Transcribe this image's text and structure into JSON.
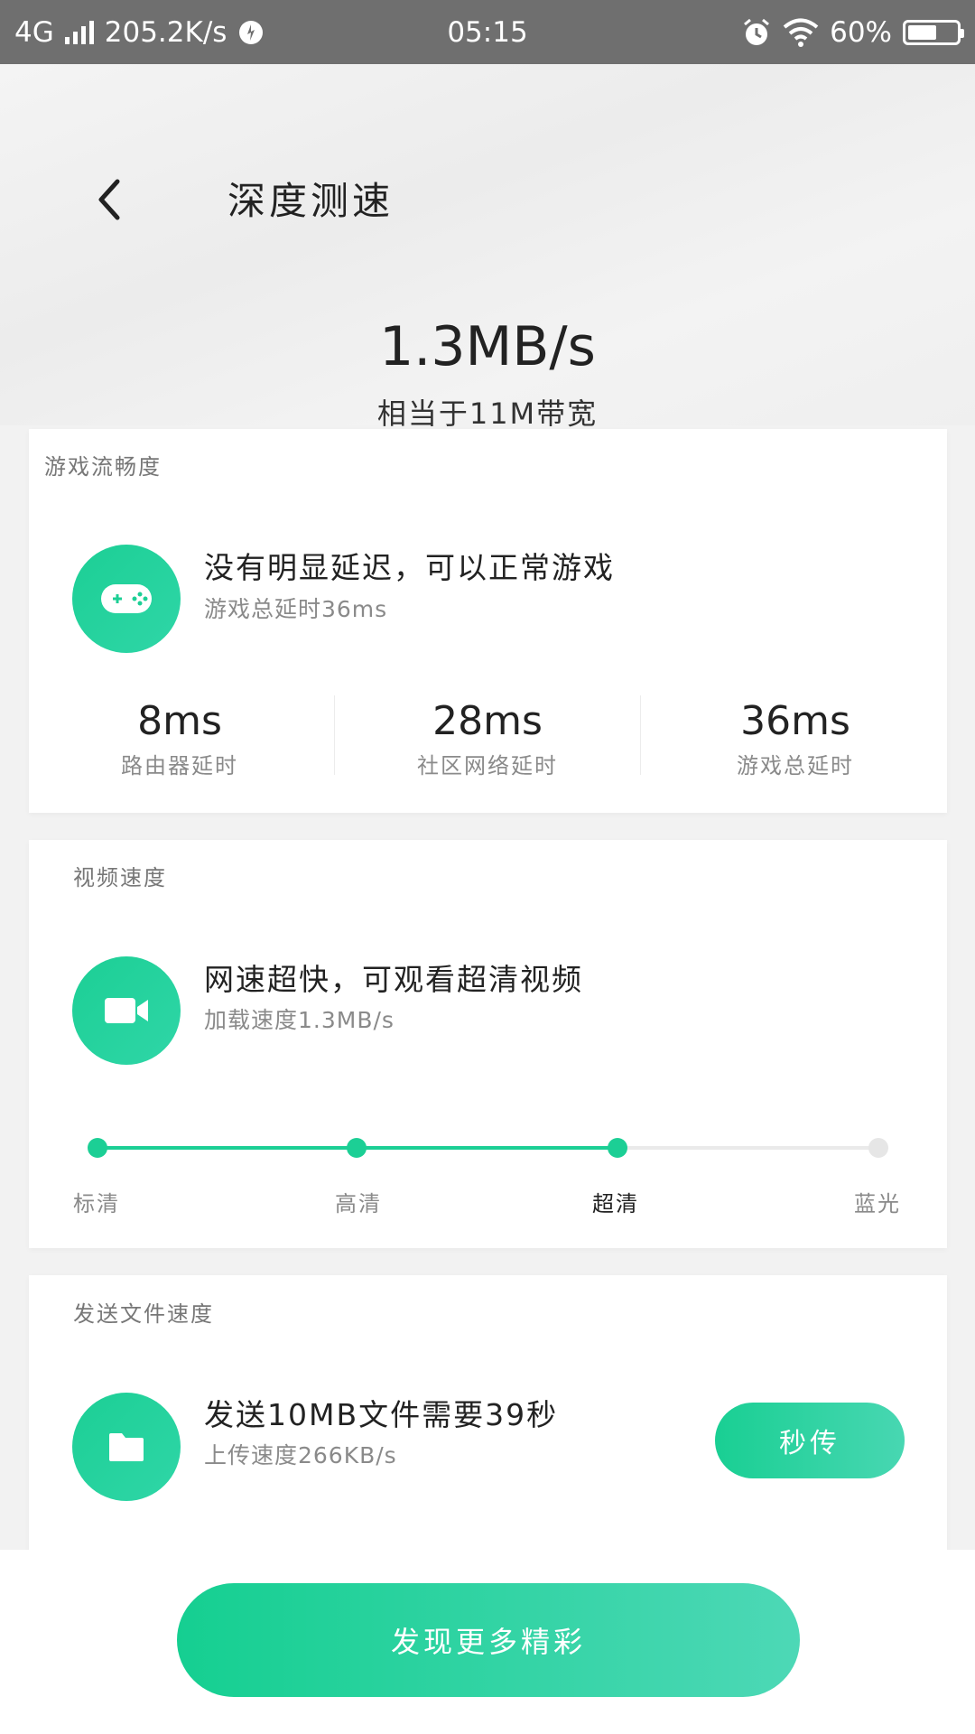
{
  "status_bar": {
    "network": "4G",
    "speed": "205.2K/s",
    "time": "05:15",
    "battery": "60%",
    "battery_level": 0.6
  },
  "header": {
    "title": "深度测速",
    "speed_value": "1.3MB/s",
    "speed_desc": "相当于11M带宽"
  },
  "game_card": {
    "title": "游戏流畅度",
    "message": "没有明显延迟，可以正常游戏",
    "sub": "游戏总延时36ms",
    "icon": "gamepad-icon",
    "stats": [
      {
        "value": "8ms",
        "label": "路由器延时"
      },
      {
        "value": "28ms",
        "label": "社区网络延时"
      },
      {
        "value": "36ms",
        "label": "游戏总延时"
      }
    ]
  },
  "video_card": {
    "title": "视频速度",
    "message": "网速超快，可观看超清视频",
    "sub": "加载速度1.3MB/s",
    "icon": "video-camera-icon",
    "levels": [
      "标清",
      "高清",
      "超清",
      "蓝光"
    ],
    "active_level_index": 2
  },
  "file_card": {
    "title": "发送文件速度",
    "message": "发送10MB文件需要39秒",
    "sub": "上传速度266KB/s",
    "icon": "folder-icon",
    "button_label": "秒传"
  },
  "bottom": {
    "button_label": "发现更多精彩"
  },
  "colors": {
    "accent": "#1ccf95",
    "status_bar_bg": "#6f6f6f"
  }
}
